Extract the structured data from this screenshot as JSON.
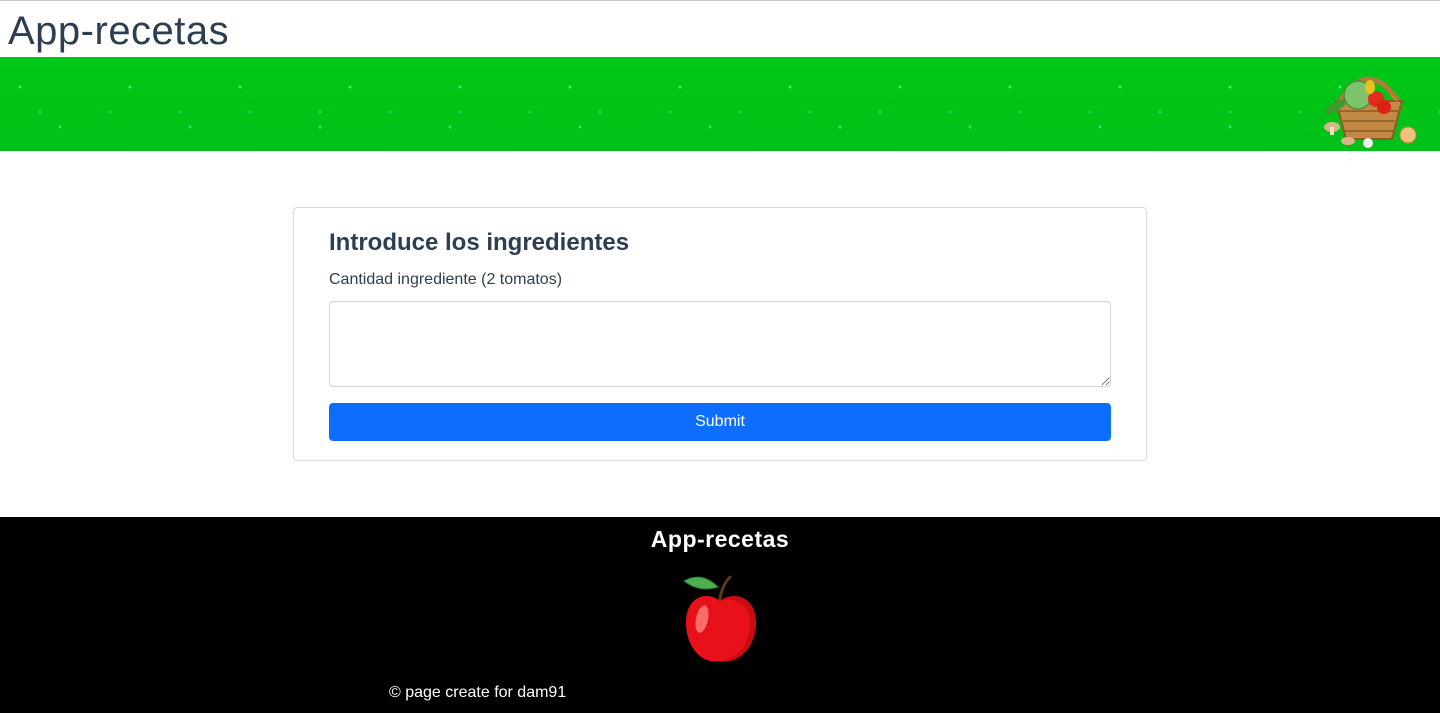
{
  "header": {
    "app_title": "App-recetas"
  },
  "banner": {
    "image_icon": "vegetable-basket-icon",
    "background_color": "#00c617"
  },
  "form": {
    "title": "Introduce los ingredientes",
    "field_label": "Cantidad ingrediente (2 tomatos)",
    "field_value": "",
    "submit_label": "Submit",
    "submit_color": "#0d6efd"
  },
  "footer": {
    "title": "App-recetas",
    "logo_icon": "apple-icon",
    "copyright": "© page create for dam91"
  }
}
